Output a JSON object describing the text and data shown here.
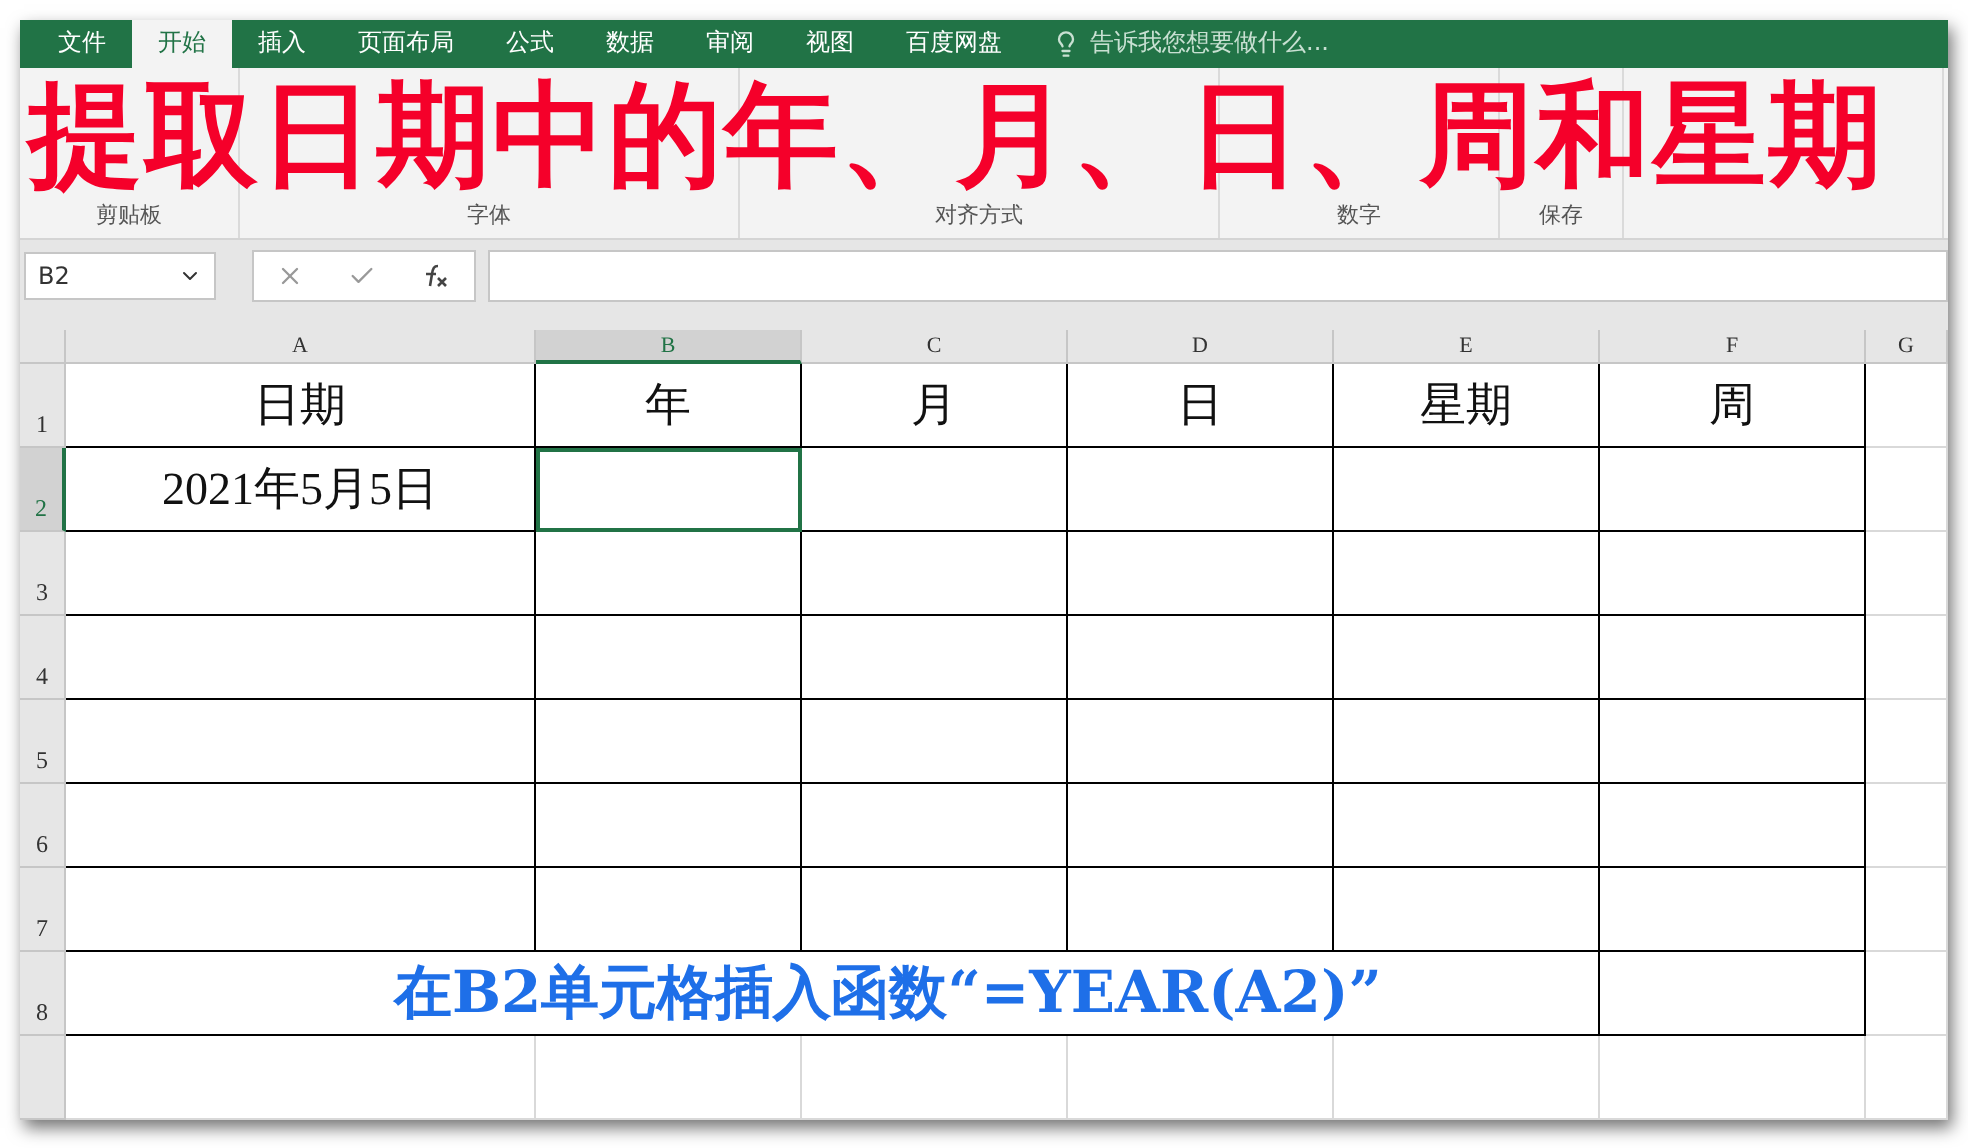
{
  "tabs": [
    {
      "label": "文件",
      "selected": false
    },
    {
      "label": "开始",
      "selected": true
    },
    {
      "label": "插入",
      "selected": false
    },
    {
      "label": "页面布局",
      "selected": false
    },
    {
      "label": "公式",
      "selected": false
    },
    {
      "label": "数据",
      "selected": false
    },
    {
      "label": "审阅",
      "selected": false
    },
    {
      "label": "视图",
      "selected": false
    },
    {
      "label": "百度网盘",
      "selected": false
    }
  ],
  "tell_me": "告诉我您想要做什么...",
  "ribbon_groups": [
    "剪贴板",
    "字体",
    "对齐方式",
    "数字",
    "保存"
  ],
  "overlay_title": "提取日期中的年、月、日、周和星期",
  "name_box": "B2",
  "columns": [
    {
      "label": "A",
      "selected": false
    },
    {
      "label": "B",
      "selected": true
    },
    {
      "label": "C",
      "selected": false
    },
    {
      "label": "D",
      "selected": false
    },
    {
      "label": "E",
      "selected": false
    },
    {
      "label": "F",
      "selected": false
    },
    {
      "label": "G",
      "selected": false
    }
  ],
  "rows": [
    {
      "header": "1",
      "selected": false,
      "cells": [
        "日期",
        "年",
        "月",
        "日",
        "星期",
        "周"
      ]
    },
    {
      "header": "2",
      "selected": true,
      "cells": [
        "2021年5月5日"
      ]
    },
    {
      "header": "3",
      "selected": false
    },
    {
      "header": "4",
      "selected": false
    },
    {
      "header": "5",
      "selected": false
    },
    {
      "header": "6",
      "selected": false
    },
    {
      "header": "7",
      "selected": false
    },
    {
      "header": "8",
      "selected": false
    }
  ],
  "caption": "在B2单元格插入函数“=YEAR(A2)”"
}
